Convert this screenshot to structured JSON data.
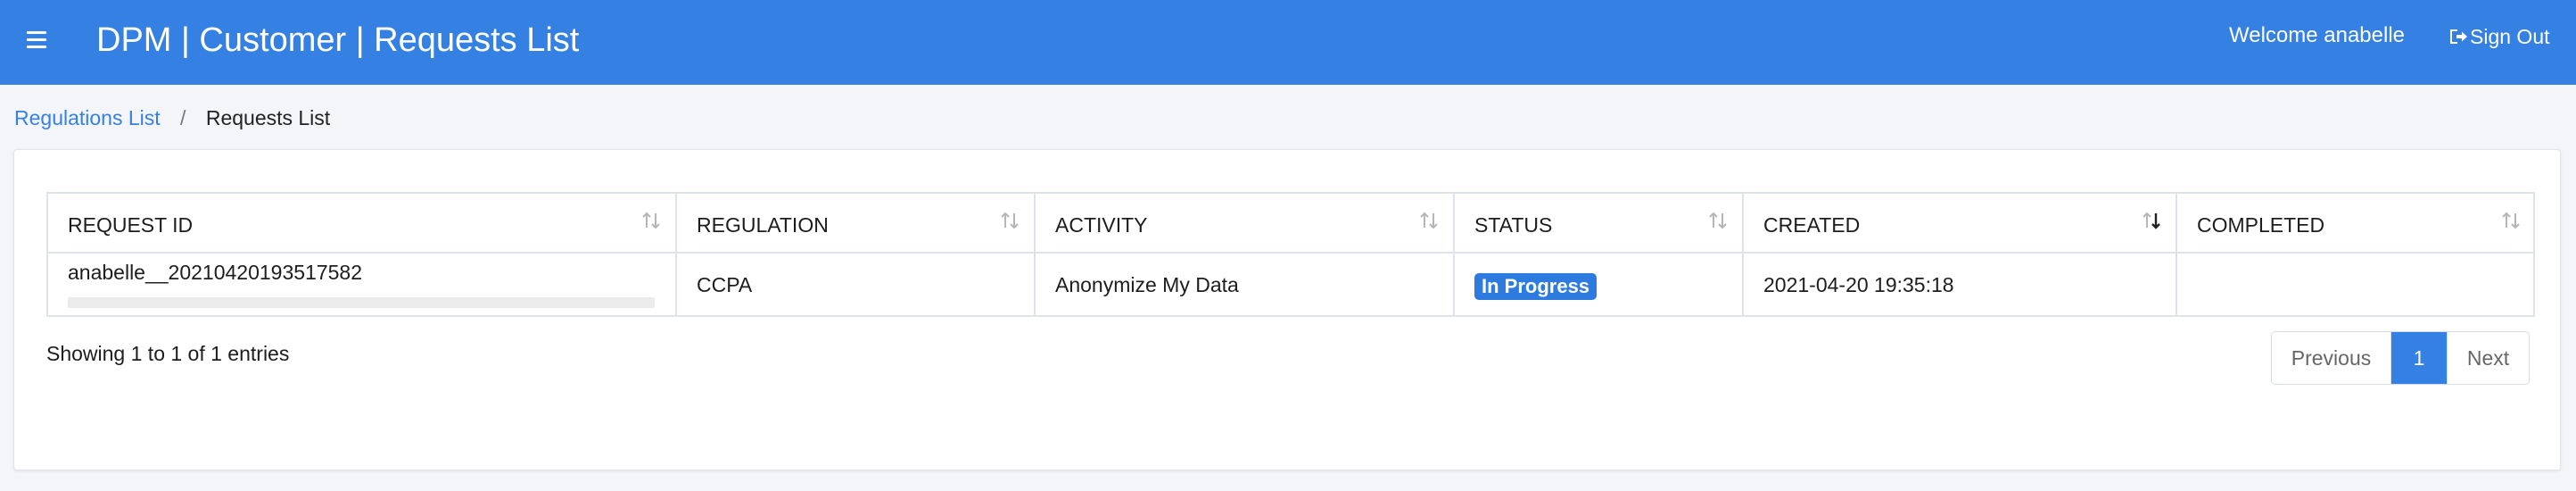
{
  "header": {
    "title": "DPM | Customer | Requests List",
    "welcome": "Welcome anabelle",
    "sign_out": "Sign Out",
    "accent_color": "#3580e3"
  },
  "breadcrumb": {
    "parent": "Regulations List",
    "separator": "/",
    "current": "Requests List"
  },
  "table": {
    "columns": [
      "REQUEST ID",
      "REGULATION",
      "ACTIVITY",
      "STATUS",
      "CREATED",
      "COMPLETED"
    ],
    "sorted_column": "CREATED",
    "sort_direction": "descending",
    "rows": [
      {
        "request_id": "anabelle__20210420193517582",
        "regulation": "CCPA",
        "activity": "Anonymize My Data",
        "status": "In Progress",
        "created": "2021-04-20 19:35:18",
        "completed": ""
      }
    ],
    "status_color": "#2e7be0"
  },
  "footer": {
    "info": "Showing 1 to 1 of 1 entries",
    "previous": "Previous",
    "page": "1",
    "next": "Next"
  }
}
